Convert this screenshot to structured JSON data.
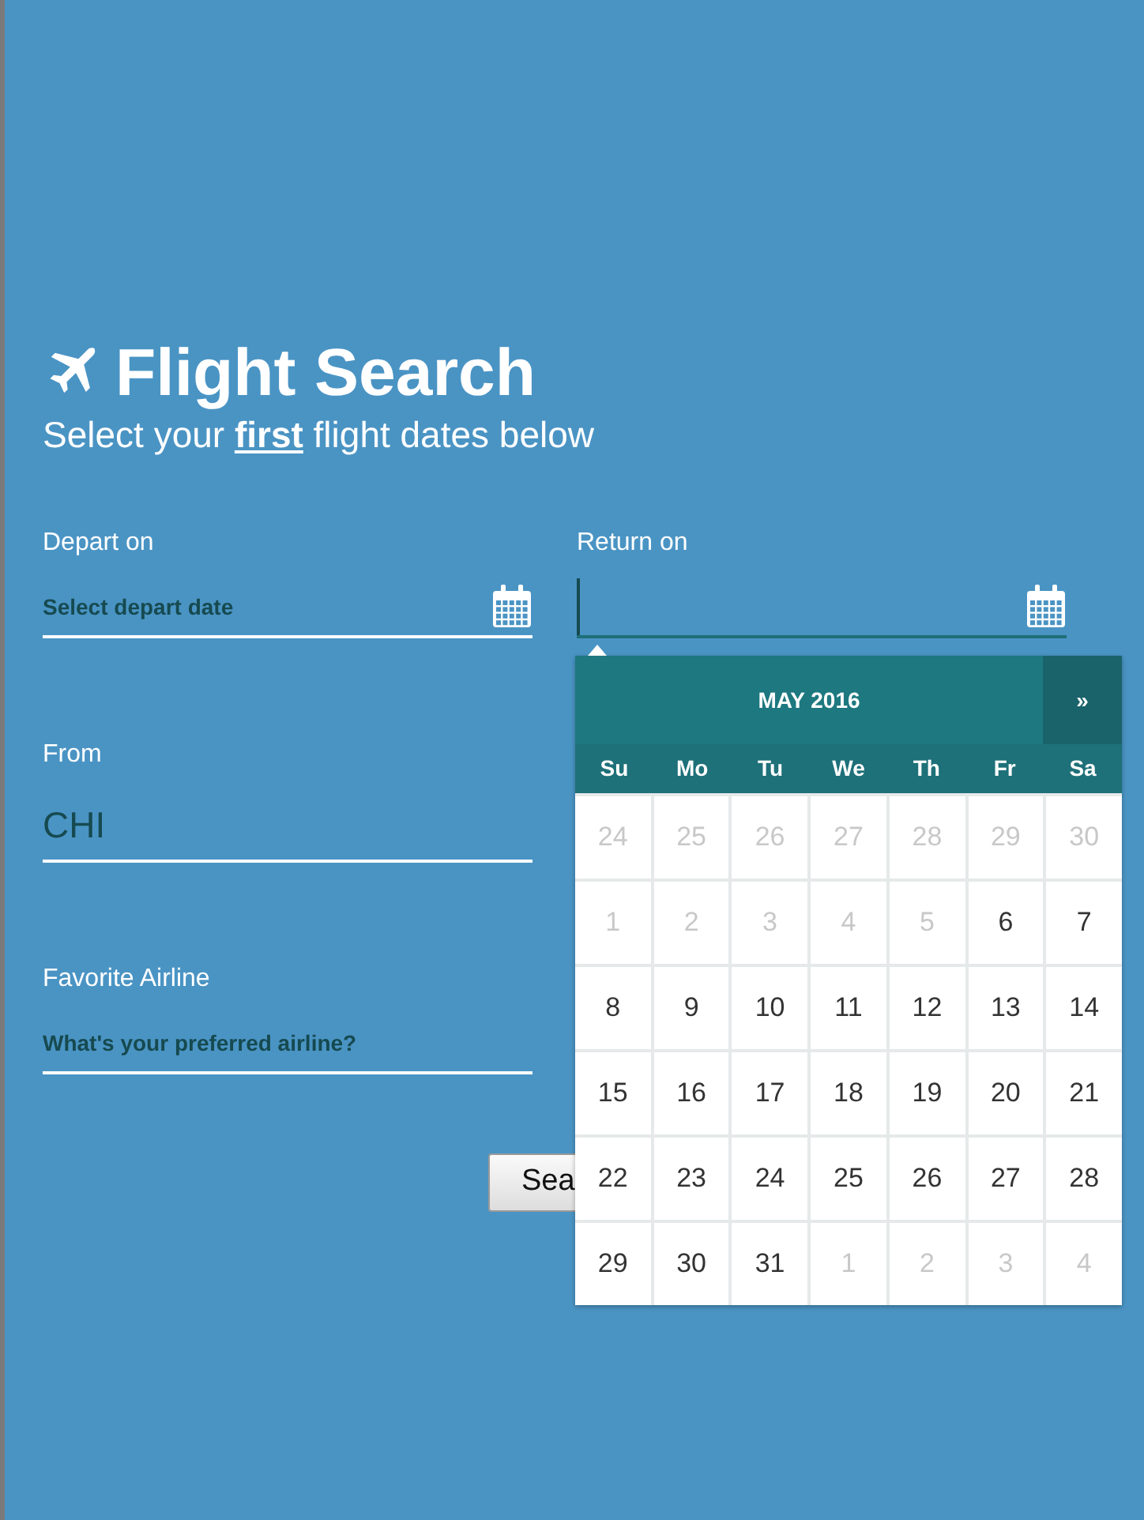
{
  "title": "Flight Search",
  "subtitle": "Select your **first** flight dates below",
  "fields": [
    {
      "kind": "date",
      "label": "Depart on",
      "placeholder": "Select depart date",
      "focused": false
    },
    {
      "kind": "date",
      "label": "Return on",
      "focused": true
    },
    {
      "kind": "text",
      "label": "From",
      "value": "CHI",
      "focused": false
    },
    {
      "kind": "text",
      "label": "Favorite Airline",
      "placeholder": "What's your preferred airline?",
      "focused": false
    }
  ],
  "search_button": "Sea",
  "datepicker": {
    "month": "MAY 2016",
    "next": "»",
    "weekdays": [
      "Su",
      "Mo",
      "Tu",
      "We",
      "Th",
      "Fr",
      "Sa"
    ],
    "weeks": [
      [
        {
          "day": "24",
          "disabled": true
        },
        {
          "day": "25",
          "disabled": true
        },
        {
          "day": "26",
          "disabled": true
        },
        {
          "day": "27",
          "disabled": true
        },
        {
          "day": "28",
          "disabled": true
        },
        {
          "day": "29",
          "disabled": true
        },
        {
          "day": "30",
          "disabled": true
        }
      ],
      [
        {
          "day": "1",
          "disabled": true
        },
        {
          "day": "2",
          "disabled": true
        },
        {
          "day": "3",
          "disabled": true
        },
        {
          "day": "4",
          "disabled": true
        },
        {
          "day": "5",
          "disabled": true
        },
        {
          "day": "6",
          "disabled": false
        },
        {
          "day": "7",
          "disabled": false
        }
      ],
      [
        {
          "day": "8",
          "disabled": false
        },
        {
          "day": "9",
          "disabled": false
        },
        {
          "day": "10",
          "disabled": false
        },
        {
          "day": "11",
          "disabled": false
        },
        {
          "day": "12",
          "disabled": false
        },
        {
          "day": "13",
          "disabled": false
        },
        {
          "day": "14",
          "disabled": false
        }
      ],
      [
        {
          "day": "15",
          "disabled": false
        },
        {
          "day": "16",
          "disabled": false
        },
        {
          "day": "17",
          "disabled": false
        },
        {
          "day": "18",
          "disabled": false
        },
        {
          "day": "19",
          "disabled": false
        },
        {
          "day": "20",
          "disabled": false
        },
        {
          "day": "21",
          "disabled": false
        }
      ],
      [
        {
          "day": "22",
          "disabled": false
        },
        {
          "day": "23",
          "disabled": false
        },
        {
          "day": "24",
          "disabled": false
        },
        {
          "day": "25",
          "disabled": false
        },
        {
          "day": "26",
          "disabled": false
        },
        {
          "day": "27",
          "disabled": false
        },
        {
          "day": "28",
          "disabled": false
        }
      ],
      [
        {
          "day": "29",
          "disabled": false
        },
        {
          "day": "30",
          "disabled": false
        },
        {
          "day": "31",
          "disabled": false
        },
        {
          "day": "1",
          "disabled": true
        },
        {
          "day": "2",
          "disabled": true
        },
        {
          "day": "3",
          "disabled": true
        },
        {
          "day": "4",
          "disabled": true
        }
      ]
    ]
  }
}
